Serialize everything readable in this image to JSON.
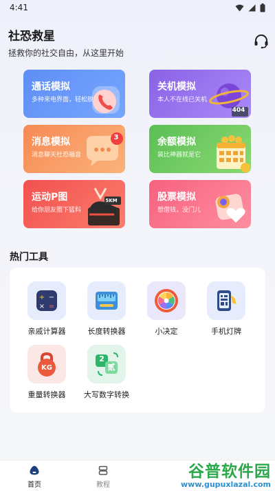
{
  "status_bar": {
    "time": "4:41"
  },
  "header": {
    "title": "社恐救星",
    "subtitle": "拯救你的社交自由，从这里开始"
  },
  "cards": [
    {
      "title": "通话模拟",
      "subtitle": "多种来电界面，轻松脱身"
    },
    {
      "title": "关机模拟",
      "subtitle": "本人不在线已关机",
      "badge": "404"
    },
    {
      "title": "消息模拟",
      "subtitle": "消息聊天社恐福音",
      "badge": "3"
    },
    {
      "title": "余额模拟",
      "subtitle": "装比神器就是它"
    },
    {
      "title": "运动P图",
      "subtitle": "给你朋友圈下猛料",
      "badge": "5KM"
    },
    {
      "title": "股票模拟",
      "subtitle": "想僧钱，没门儿"
    }
  ],
  "tools": {
    "title": "热门工具",
    "items": [
      {
        "label": "亲戚计算器",
        "icon": "calculator-icon"
      },
      {
        "label": "长度转换器",
        "icon": "ruler-icon"
      },
      {
        "label": "小决定",
        "icon": "spinner-wheel-icon"
      },
      {
        "label": "手机灯牌",
        "icon": "phone-lightboard-icon"
      },
      {
        "label": "重量转换器",
        "icon": "kettlebell-icon",
        "badge": "KG"
      },
      {
        "label": "大写数字转换",
        "icon": "number-convert-icon",
        "badge_a": "2",
        "badge_b": "贰"
      }
    ]
  },
  "bottom_nav": {
    "items": [
      {
        "label": "首页",
        "icon": "home-icon",
        "active": true
      },
      {
        "label": "教程",
        "icon": "tutorial-icon",
        "active": false
      }
    ]
  },
  "watermark": {
    "line1": "谷普软件园",
    "line2": "www.gupuxlazal.com"
  }
}
